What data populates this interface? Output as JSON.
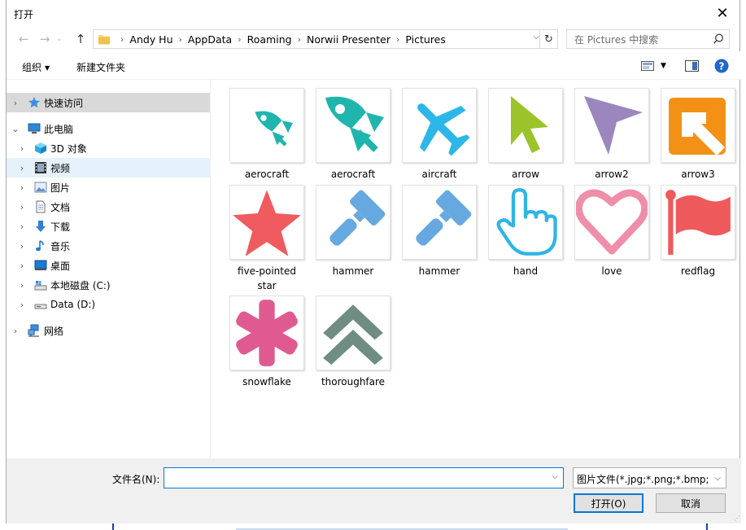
{
  "window": {
    "title": "打开"
  },
  "address": {
    "crumbs": [
      "Andy Hu",
      "AppData",
      "Roaming",
      "Norwii Presenter",
      "Pictures"
    ]
  },
  "search": {
    "placeholder": "在 Pictures 中搜索"
  },
  "toolbar": {
    "organize_label": "组织",
    "new_folder_label": "新建文件夹"
  },
  "sidebar": {
    "items": [
      {
        "label": "快速访问",
        "icon": "star-pin-icon"
      },
      {
        "label": "此电脑",
        "icon": "computer-icon"
      },
      {
        "label": "3D 对象",
        "icon": "cube-icon"
      },
      {
        "label": "视频",
        "icon": "film-icon"
      },
      {
        "label": "图片",
        "icon": "picture-icon"
      },
      {
        "label": "文档",
        "icon": "document-icon"
      },
      {
        "label": "下载",
        "icon": "download-arrow-icon"
      },
      {
        "label": "音乐",
        "icon": "music-note-icon"
      },
      {
        "label": "桌面",
        "icon": "desktop-icon"
      },
      {
        "label": "本地磁盘 (C:)",
        "icon": "drive-c-icon"
      },
      {
        "label": "Data (D:)",
        "icon": "drive-icon"
      },
      {
        "label": "网络",
        "icon": "network-icon"
      }
    ]
  },
  "files": [
    {
      "label": "aerocraft",
      "icon": "small-rocket-icon",
      "color": "#1fb5ad"
    },
    {
      "label": "aerocraft",
      "icon": "rocket-icon",
      "color": "#1fb5ad"
    },
    {
      "label": "aircraft",
      "icon": "airplane-icon",
      "color": "#2cb7e8"
    },
    {
      "label": "arrow",
      "icon": "green-cursor-arrow-icon",
      "color": "#9bc32a"
    },
    {
      "label": "arrow2",
      "icon": "purple-cursor-arrow-icon",
      "color": "#9b87be"
    },
    {
      "label": "arrow3",
      "icon": "orange-corner-arrow-icon",
      "color": "#f39116"
    },
    {
      "label": "five-pointed star",
      "icon": "star-icon",
      "color": "#ef5b5e"
    },
    {
      "label": "hammer",
      "icon": "hammer-icon",
      "color": "#66a9e0"
    },
    {
      "label": "hammer",
      "icon": "hammer-icon",
      "color": "#66a9e0"
    },
    {
      "label": "hand",
      "icon": "pointing-hand-icon",
      "color": "#2fb4e6"
    },
    {
      "label": "love",
      "icon": "heart-outline-icon",
      "color": "#ef8ea8"
    },
    {
      "label": "redflag",
      "icon": "flag-icon",
      "color": "#ee5a5c"
    },
    {
      "label": "snowflake",
      "icon": "asterisk-icon",
      "color": "#e05a92"
    },
    {
      "label": "thoroughfare",
      "icon": "double-chevron-up-icon",
      "color": "#6f8d82"
    }
  ],
  "footer": {
    "filename_label": "文件名(N):",
    "filename_value": "",
    "filter_value": "图片文件(*.jpg;*.png;*.bmp;*.gif)",
    "open_label": "打开(O)",
    "cancel_label": "取消"
  }
}
